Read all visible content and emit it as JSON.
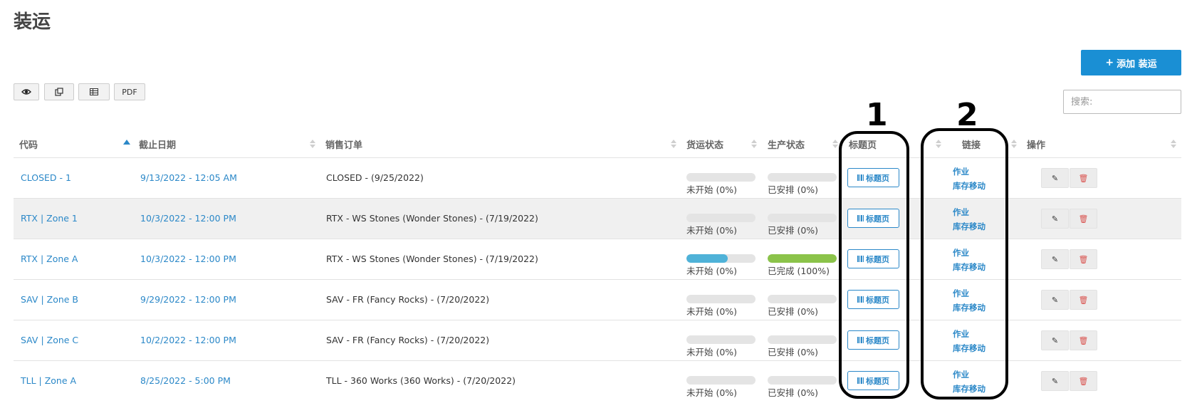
{
  "page": {
    "title": "装运"
  },
  "toolbar": {
    "add_label": "添加 装运",
    "add_icon": "plus-icon",
    "pdf_label": "PDF",
    "search_placeholder": "搜索:",
    "view_icon": "eye-icon",
    "copy_icon": "copy-icon",
    "excel_icon": "table-icon"
  },
  "columns": {
    "code": "代码",
    "deadline": "截止日期",
    "sales_order": "销售订单",
    "ship_status": "货运状态",
    "prod_status": "生产状态",
    "title_page": "标题页",
    "links": "链接",
    "actions": "操作"
  },
  "rows": [
    {
      "code": "CLOSED - 1",
      "deadline": "9/13/2022 - 12:05 AM",
      "sales_order": "CLOSED - (9/25/2022)",
      "ship_label": "未开始 (0%)",
      "ship_progress": 0,
      "prod_label": "已安排 (0%)",
      "prod_progress": 0,
      "title_btn": "标题页",
      "link1": "作业",
      "link2": "库存移动"
    },
    {
      "code": "RTX | Zone 1",
      "deadline": "10/3/2022 - 12:00 PM",
      "sales_order": "RTX - WS Stones (Wonder Stones) - (7/19/2022)",
      "ship_label": "未开始 (0%)",
      "ship_progress": 0,
      "prod_label": "已安排 (0%)",
      "prod_progress": 0,
      "title_btn": "标题页",
      "link1": "作业",
      "link2": "库存移动"
    },
    {
      "code": "RTX | Zone A",
      "deadline": "10/3/2022 - 12:00 PM",
      "sales_order": "RTX - WS Stones (Wonder Stones) - (7/19/2022)",
      "ship_label": "未开始 (0%)",
      "ship_progress": 0.6,
      "prod_label": "已完成 (100%)",
      "prod_progress": 1.0,
      "title_btn": "标题页",
      "link1": "作业",
      "link2": "库存移动"
    },
    {
      "code": "SAV | Zone B",
      "deadline": "9/29/2022 - 12:00 PM",
      "sales_order": "SAV - FR (Fancy Rocks) - (7/20/2022)",
      "ship_label": "未开始 (0%)",
      "ship_progress": 0,
      "prod_label": "已安排 (0%)",
      "prod_progress": 0,
      "title_btn": "标题页",
      "link1": "作业",
      "link2": "库存移动"
    },
    {
      "code": "SAV | Zone C",
      "deadline": "10/2/2022 - 12:00 PM",
      "sales_order": "SAV - FR (Fancy Rocks) - (7/20/2022)",
      "ship_label": "未开始 (0%)",
      "ship_progress": 0,
      "prod_label": "已安排 (0%)",
      "prod_progress": 0,
      "title_btn": "标题页",
      "link1": "作业",
      "link2": "库存移动"
    },
    {
      "code": "TLL | Zone A",
      "deadline": "8/25/2022 - 5:00 PM",
      "sales_order": "TLL - 360 Works (360 Works) - (7/20/2022)",
      "ship_label": "未开始 (0%)",
      "ship_progress": 0,
      "prod_label": "已安排 (0%)",
      "prod_progress": 0,
      "title_btn": "标题页",
      "link1": "作业",
      "link2": "库存移动"
    }
  ],
  "annotations": {
    "callout1": "1",
    "callout2": "2"
  },
  "colors": {
    "accent": "#2b88c8",
    "button": "#1a8fd4",
    "ship_bar": "#4fb2d8",
    "prod_bar": "#8bc34a",
    "delete": "#d9534f",
    "callout": "#000000"
  }
}
